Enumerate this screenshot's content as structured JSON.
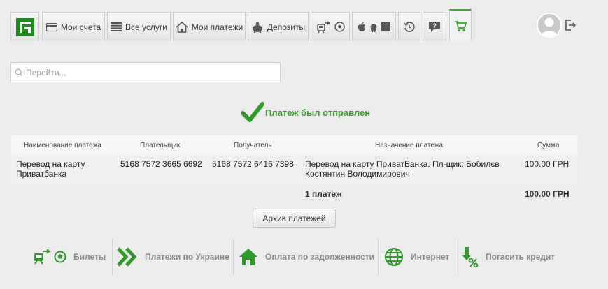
{
  "nav": {
    "tabs": [
      {
        "id": "accounts",
        "label": "Мои счета"
      },
      {
        "id": "services",
        "label": "Все услуги"
      },
      {
        "id": "payments",
        "label": "Мои платежи"
      },
      {
        "id": "deposits",
        "label": "Депозиты"
      }
    ]
  },
  "search": {
    "placeholder": "Перейти..."
  },
  "status": {
    "message": "Платеж был отправлен"
  },
  "table": {
    "headers": [
      "Наименование платежа",
      "Плательщик",
      "Получатель",
      "Назначение платежа",
      "Сумма"
    ],
    "rows": [
      {
        "name": [
          "Перевод на карту",
          "Приватбанка"
        ],
        "payer": "5168 7572 3665 6692",
        "recipient": "5168 7572 6416 7398",
        "purpose": [
          "Перевод на карту ПриватБанка. Пл-щик: Бобилєв",
          "Костянтин Володимирович"
        ],
        "amount": "100.00 ГРН"
      }
    ],
    "total_count": "1 платеж",
    "total_amount": "100.00 ГРН"
  },
  "archive_button": "Архив платежей",
  "quick_links": [
    {
      "id": "tickets",
      "label": "Билеты"
    },
    {
      "id": "ukraine",
      "label": "Платежи по Украине"
    },
    {
      "id": "debts",
      "label": "Оплата по задолженности"
    },
    {
      "id": "internet",
      "label": "Интернет"
    },
    {
      "id": "loan",
      "label": "Погасить кредит"
    }
  ],
  "colors": {
    "accent": "#3a9c2c",
    "logo": "#1e8a1e",
    "text": "#333333"
  }
}
